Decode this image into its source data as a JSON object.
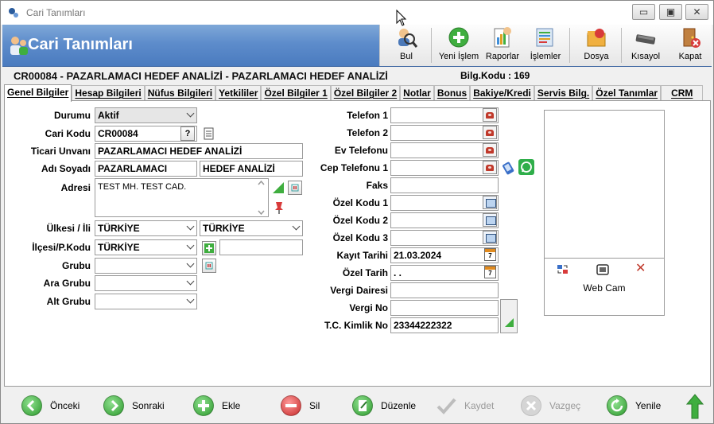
{
  "window": {
    "title": "Cari Tanımları"
  },
  "header": {
    "title": "Cari Tanımları"
  },
  "toolbar": {
    "bul": "Bul",
    "yeni_islem": "Yeni İşlem",
    "raporlar": "Raporlar",
    "islemler": "İşlemler",
    "dosya": "Dosya",
    "kisayol": "Kısayol",
    "kapat": "Kapat"
  },
  "info": {
    "record_line": "CR00084  -  PAZARLAMACI HEDEF ANALİZİ   -   PAZARLAMACI   HEDEF ANALİZİ",
    "bilg_kodu": "Bilg.Kodu : 169"
  },
  "tabs": [
    "Genel Bilgiler",
    "Hesap Bilgileri",
    "Nüfus Bilgileri",
    "Yetkililer",
    "Özel Bilgiler 1",
    "Özel Bilgiler 2",
    "Notlar",
    "Bonus",
    "Bakiye/Kredi",
    "Servis Bilg.",
    "Özel Tanımlar",
    "CRM"
  ],
  "form": {
    "durumu_label": "Durumu",
    "durumu_value": "Aktif",
    "cari_kodu_label": "Cari Kodu",
    "cari_kodu_value": "CR00084",
    "ticari_unvani_label": "Ticari Unvanı",
    "ticari_unvani_value": "PAZARLAMACI HEDEF ANALİZİ",
    "adi_soyadi_label": "Adı Soyadı",
    "adi_value": "PAZARLAMACI",
    "soyadi_value": "HEDEF ANALİZİ",
    "adresi_label": "Adresi",
    "adresi_value": "TEST MH. TEST CAD.",
    "ulkesi_il_label": "Ülkesi / İli",
    "ulkesi_value": "TÜRKİYE",
    "il_value": "TÜRKİYE",
    "ilce_pkodu_label": "İlçesi/P.Kodu",
    "ilce_value": "TÜRKİYE",
    "pkodu_value": "",
    "grubu_label": "Grubu",
    "ara_grubu_label": "Ara Grubu",
    "alt_grubu_label": "Alt Grubu",
    "telefon1_label": "Telefon 1",
    "telefon2_label": "Telefon 2",
    "ev_telefonu_label": "Ev Telefonu",
    "cep_telefonu1_label": "Cep Telefonu 1",
    "faks_label": "Faks",
    "ozel_kodu1_label": "Özel Kodu 1",
    "ozel_kodu2_label": "Özel Kodu 2",
    "ozel_kodu3_label": "Özel Kodu 3",
    "kayit_tarihi_label": "Kayıt Tarihi",
    "kayit_tarihi_value": "21.03.2024",
    "ozel_tarih_label": "Özel Tarih",
    "ozel_tarih_value": " .  .",
    "vergi_dairesi_label": "Vergi Dairesi",
    "vergi_no_label": "Vergi No",
    "tc_kimlik_label": "T.C. Kimlik No",
    "tc_kimlik_value": "23344222322",
    "web_cam_label": "Web Cam",
    "cal_day": "7"
  },
  "bottom": {
    "onceki": "Önceki",
    "sonraki": "Sonraki",
    "ekle": "Ekle",
    "sil": "Sil",
    "duzenle": "Düzenle",
    "kaydet": "Kaydet",
    "vazgec": "Vazgeç",
    "yenile": "Yenile"
  },
  "colors": {
    "header_blue": "#5d8ccb",
    "green": "#3fae3f",
    "red": "#d83a3a"
  }
}
